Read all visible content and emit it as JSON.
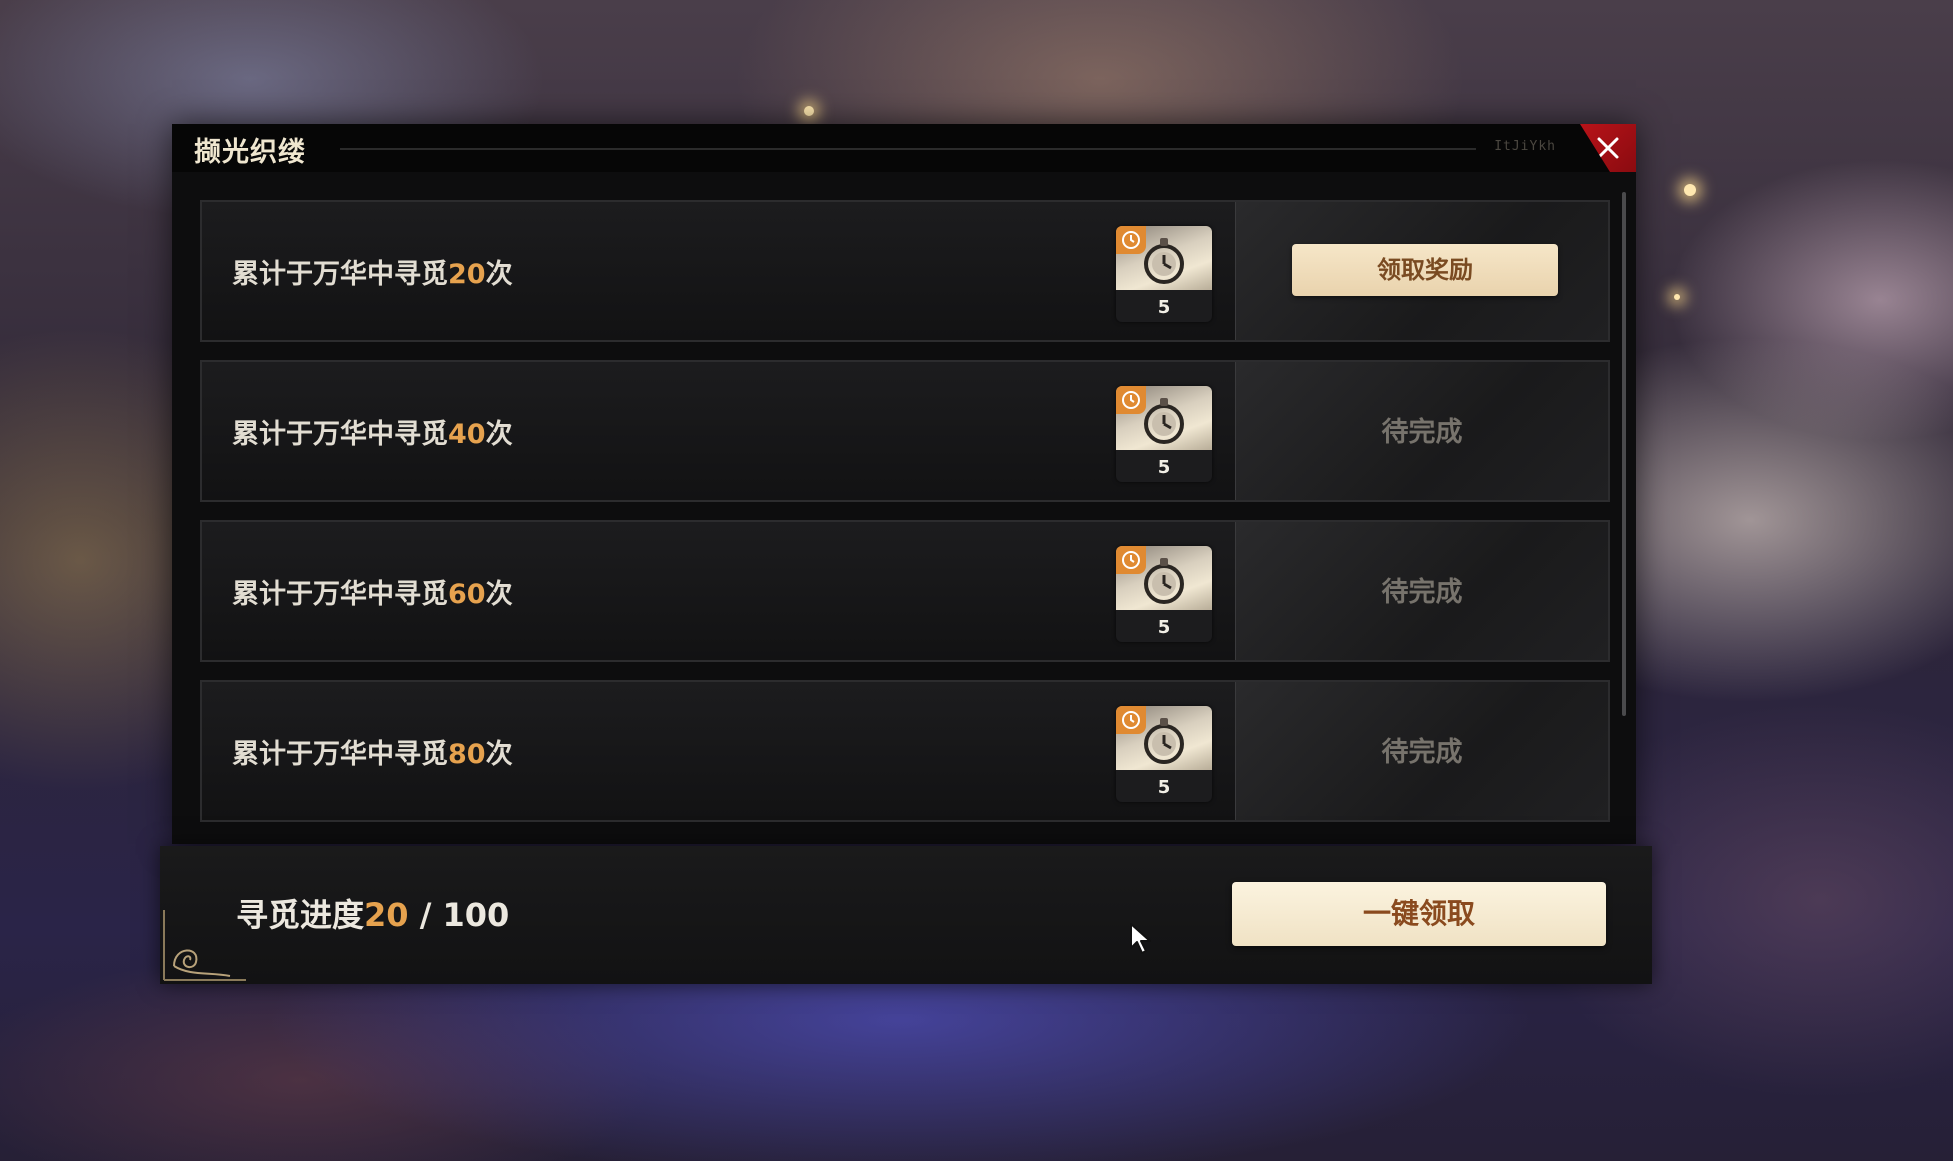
{
  "window": {
    "title": "撷光织缕",
    "title_deco": "ItJiYkh",
    "close_icon": "close-icon"
  },
  "tasks": [
    {
      "prefix": "累计于万华中寻觅",
      "count": "20",
      "suffix": "次",
      "reward_count": "5",
      "action_label": "领取奖励",
      "status": "claimable"
    },
    {
      "prefix": "累计于万华中寻觅",
      "count": "40",
      "suffix": "次",
      "reward_count": "5",
      "action_label": "待完成",
      "status": "pending"
    },
    {
      "prefix": "累计于万华中寻觅",
      "count": "60",
      "suffix": "次",
      "reward_count": "5",
      "action_label": "待完成",
      "status": "pending"
    },
    {
      "prefix": "累计于万华中寻觅",
      "count": "80",
      "suffix": "次",
      "reward_count": "5",
      "action_label": "待完成",
      "status": "pending"
    }
  ],
  "footer": {
    "progress_label": "寻觅进度",
    "progress_current": "20",
    "progress_sep": " / ",
    "progress_total": "100",
    "claim_all_label": "一键领取"
  },
  "colors": {
    "accent": "#e6a24e",
    "close_red": "#c0141a",
    "button_cream": "#f6e6c8",
    "pending_gray": "#77736c"
  }
}
